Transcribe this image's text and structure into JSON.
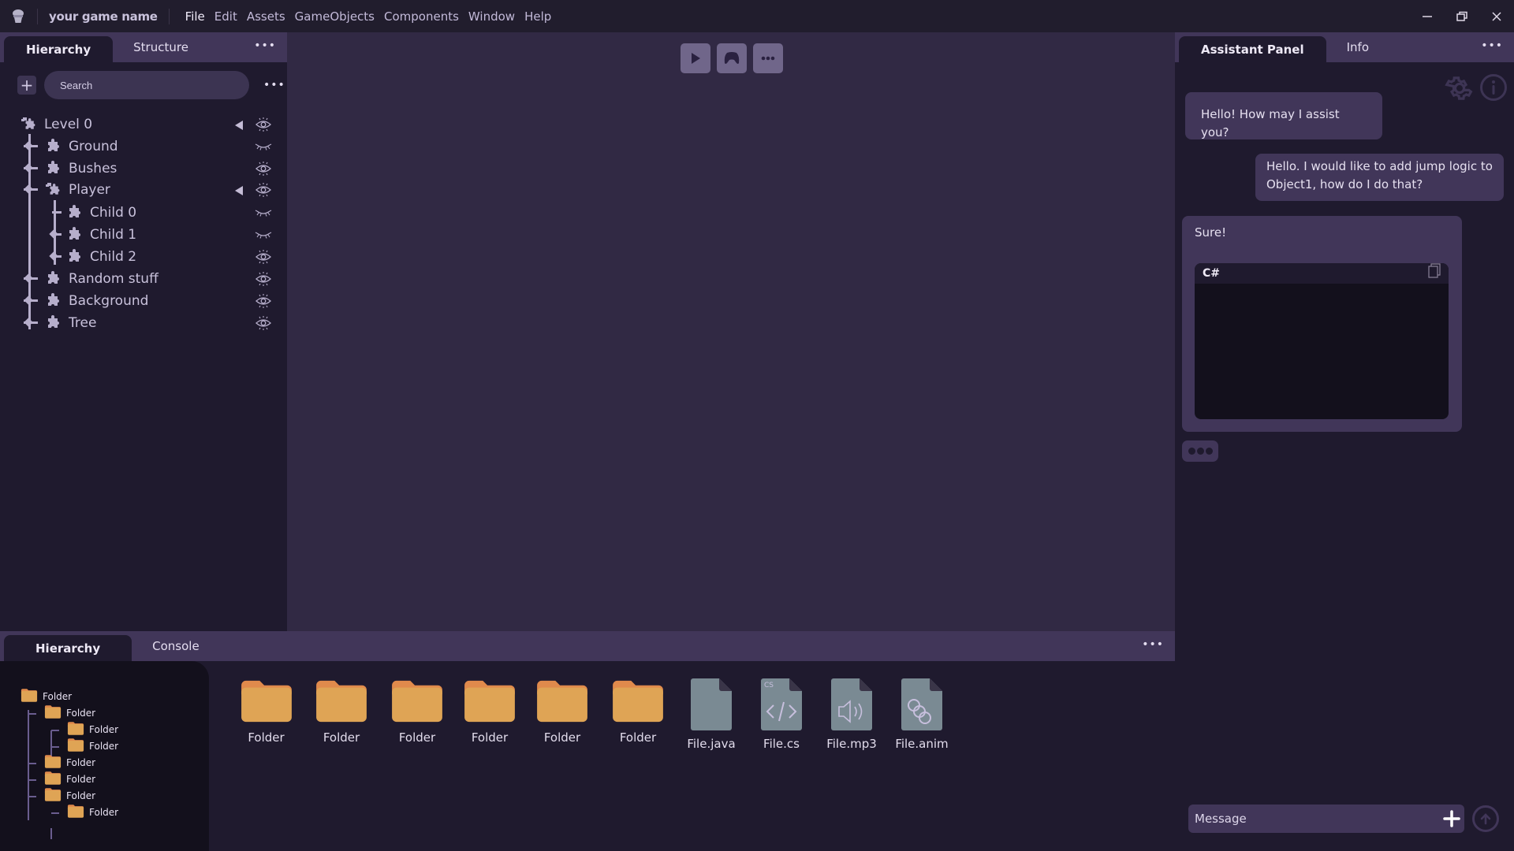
{
  "titlebar": {
    "logo_icon": "app-logo-icon",
    "game_name": "your game name",
    "menu": [
      "File",
      "Edit",
      "Assets",
      "GameObjects",
      "Components",
      "Window",
      "Help"
    ],
    "active_menu": "File",
    "window_controls": [
      "minimize-icon",
      "restore-icon",
      "close-icon"
    ]
  },
  "hierarchy_panel": {
    "tabs": [
      "Hierarchy",
      "Structure"
    ],
    "active_tab": "Hierarchy",
    "more_label": "•••",
    "add_label": "+",
    "search_placeholder": "Search",
    "tree": [
      {
        "label": "Level 0",
        "depth": 0,
        "icon": "puzzle-group-icon",
        "collapsible": true,
        "visible": true
      },
      {
        "label": "Ground",
        "depth": 1,
        "icon": "puzzle-icon",
        "collapsible": false,
        "visible": false
      },
      {
        "label": "Bushes",
        "depth": 1,
        "icon": "puzzle-icon",
        "collapsible": false,
        "visible": true
      },
      {
        "label": "Player",
        "depth": 1,
        "icon": "puzzle-group-icon",
        "collapsible": true,
        "visible": true
      },
      {
        "label": "Child 0",
        "depth": 2,
        "icon": "puzzle-icon",
        "collapsible": false,
        "visible": false
      },
      {
        "label": "Child 1",
        "depth": 2,
        "icon": "puzzle-icon",
        "collapsible": false,
        "visible": false
      },
      {
        "label": "Child 2",
        "depth": 2,
        "icon": "puzzle-icon",
        "collapsible": false,
        "visible": true
      },
      {
        "label": "Random stuff",
        "depth": 1,
        "icon": "puzzle-icon",
        "collapsible": false,
        "visible": true
      },
      {
        "label": "Background",
        "depth": 1,
        "icon": "puzzle-icon",
        "collapsible": false,
        "visible": true
      },
      {
        "label": "Tree",
        "depth": 1,
        "icon": "puzzle-icon",
        "collapsible": false,
        "visible": true
      }
    ]
  },
  "viewport": {
    "tools": [
      "play-icon",
      "gamepad-icon",
      "more-icon"
    ]
  },
  "assistant_panel": {
    "tabs": [
      "Assistant Panel",
      "Info"
    ],
    "active_tab": "Assistant Panel",
    "more_label": "•••",
    "header_icons": [
      "gear-icon",
      "info-icon"
    ],
    "messages": [
      {
        "role": "assistant",
        "text": "Hello! How may I assist you?"
      },
      {
        "role": "user",
        "text": "Hello. I would like to add jump logic to Object1, how do I do that?"
      },
      {
        "role": "assistant",
        "text": "Sure!",
        "code": {
          "language": "C#",
          "content": ""
        }
      }
    ],
    "message_placeholder": "Message"
  },
  "bottom_panel": {
    "tabs": [
      "Hierarchy",
      "Console"
    ],
    "active_tab": "Hierarchy",
    "more_label": "•••",
    "folder_tree": [
      {
        "label": "Folder",
        "depth": 0
      },
      {
        "label": "Folder",
        "depth": 1
      },
      {
        "label": "Folder",
        "depth": 2
      },
      {
        "label": "Folder",
        "depth": 2
      },
      {
        "label": "Folder",
        "depth": 1
      },
      {
        "label": "Folder",
        "depth": 1
      },
      {
        "label": "Folder",
        "depth": 1
      },
      {
        "label": "Folder",
        "depth": 2
      }
    ],
    "files": [
      {
        "label": "Folder",
        "type": "folder"
      },
      {
        "label": "Folder",
        "type": "folder"
      },
      {
        "label": "Folder",
        "type": "folder"
      },
      {
        "label": "Folder",
        "type": "folder"
      },
      {
        "label": "Folder",
        "type": "folder"
      },
      {
        "label": "Folder",
        "type": "folder"
      },
      {
        "label": "File.java",
        "type": "file"
      },
      {
        "label": "File.cs",
        "type": "code",
        "badge": "CS"
      },
      {
        "label": "File.mp3",
        "type": "audio"
      },
      {
        "label": "File.anim",
        "type": "anim"
      }
    ]
  },
  "colors": {
    "titlebar_bg": "#211d2d",
    "panel_bg": "#1f1a2e",
    "tab_strip": "#413659",
    "viewport_bg": "#312944",
    "folder": "#dfa455",
    "folder_tab": "#e08a4c",
    "file_grey": "#7a8a93",
    "text": "#c9c2dc"
  }
}
